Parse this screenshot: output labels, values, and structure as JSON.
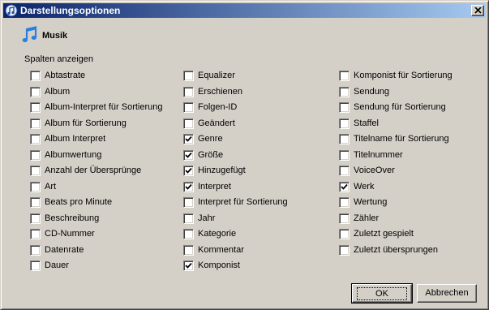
{
  "window": {
    "title": "Darstellungsoptionen"
  },
  "section": {
    "title": "Musik",
    "group_label": "Spalten anzeigen"
  },
  "columns": {
    "col1": [
      {
        "label": "Abtastrate",
        "checked": false
      },
      {
        "label": "Album",
        "checked": false
      },
      {
        "label": "Album-Interpret für Sortierung",
        "checked": false
      },
      {
        "label": "Album für Sortierung",
        "checked": false
      },
      {
        "label": "Album Interpret",
        "checked": false
      },
      {
        "label": "Albumwertung",
        "checked": false
      },
      {
        "label": "Anzahl der Übersprünge",
        "checked": false
      },
      {
        "label": "Art",
        "checked": false
      },
      {
        "label": "Beats pro Minute",
        "checked": false
      },
      {
        "label": "Beschreibung",
        "checked": false
      },
      {
        "label": "CD-Nummer",
        "checked": false
      },
      {
        "label": "Datenrate",
        "checked": false
      },
      {
        "label": "Dauer",
        "checked": false
      }
    ],
    "col2": [
      {
        "label": "Equalizer",
        "checked": false
      },
      {
        "label": "Erschienen",
        "checked": false
      },
      {
        "label": "Folgen-ID",
        "checked": false
      },
      {
        "label": "Geändert",
        "checked": false
      },
      {
        "label": "Genre",
        "checked": true
      },
      {
        "label": "Größe",
        "checked": true
      },
      {
        "label": "Hinzugefügt",
        "checked": true
      },
      {
        "label": "Interpret",
        "checked": true
      },
      {
        "label": "Interpret für Sortierung",
        "checked": false
      },
      {
        "label": "Jahr",
        "checked": false
      },
      {
        "label": "Kategorie",
        "checked": false
      },
      {
        "label": "Kommentar",
        "checked": false
      },
      {
        "label": "Komponist",
        "checked": true
      }
    ],
    "col3": [
      {
        "label": "Komponist für Sortierung",
        "checked": false
      },
      {
        "label": "Sendung",
        "checked": false
      },
      {
        "label": "Sendung für Sortierung",
        "checked": false
      },
      {
        "label": "Staffel",
        "checked": false
      },
      {
        "label": "Titelname für Sortierung",
        "checked": false
      },
      {
        "label": "Titelnummer",
        "checked": false
      },
      {
        "label": "VoiceOver",
        "checked": false
      },
      {
        "label": "Werk",
        "checked": true
      },
      {
        "label": "Wertung",
        "checked": false
      },
      {
        "label": "Zähler",
        "checked": false
      },
      {
        "label": "Zuletzt gespielt",
        "checked": false
      },
      {
        "label": "Zuletzt übersprungen",
        "checked": false
      }
    ]
  },
  "buttons": {
    "ok": "OK",
    "cancel": "Abbrechen"
  },
  "icons": {
    "title": "itunes-icon",
    "section": "music-note-icon",
    "close": "close-icon"
  },
  "colors": {
    "titlebar_start": "#0a246a",
    "titlebar_end": "#a6caf0",
    "dialog_bg": "#d4d0c8",
    "note_blue": "#2a7fe0"
  }
}
